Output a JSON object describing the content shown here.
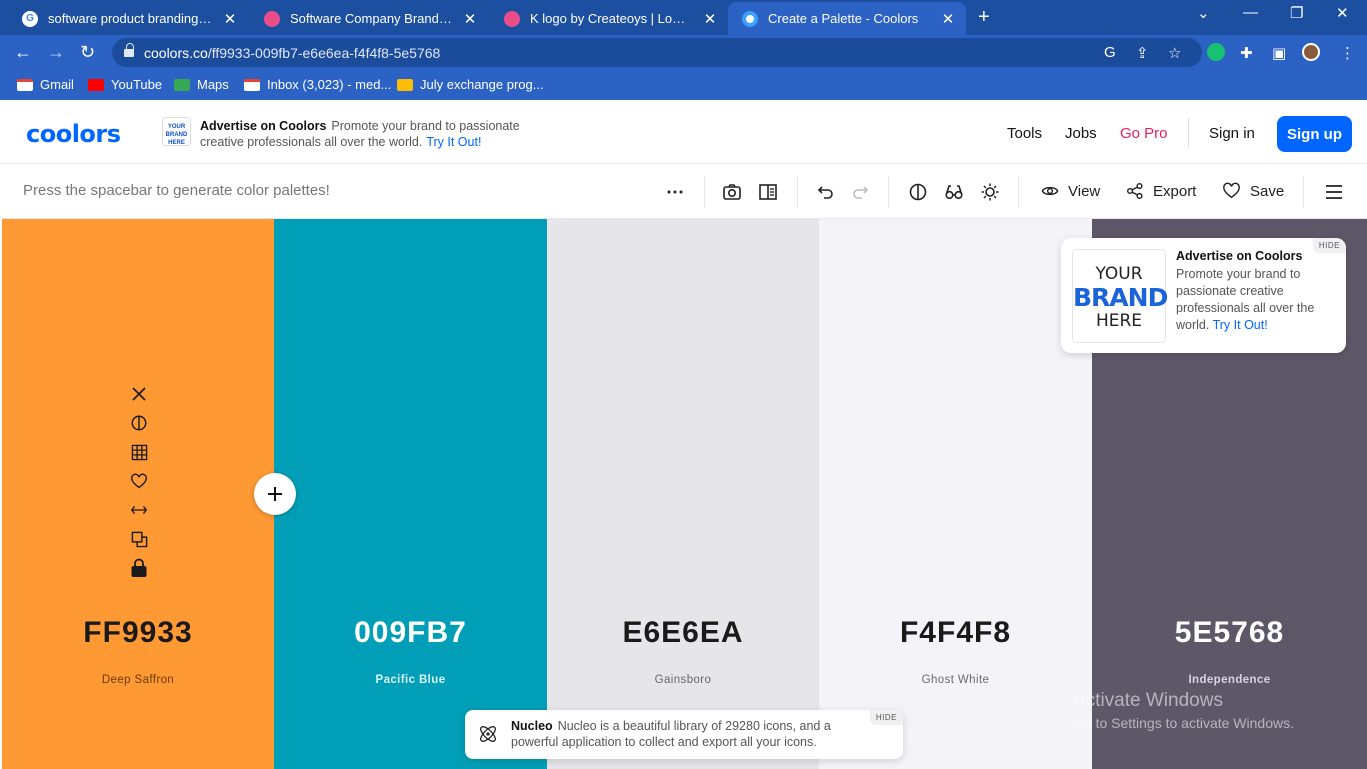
{
  "browser": {
    "tabs": [
      {
        "title": "software product branding - Goo",
        "favicon": "google-icon",
        "active": false
      },
      {
        "title": "Software Company Branding des",
        "favicon": "dribbble-icon",
        "active": false
      },
      {
        "title": "K logo by Createoys | Logo Des",
        "favicon": "dribbble-icon",
        "active": false
      },
      {
        "title": "Create a Palette - Coolors",
        "favicon": "coolors-icon",
        "active": true
      }
    ],
    "url_host": "coolors.co",
    "url_path": "/ff9933-009fb7-e6e6ea-f4f4f8-5e5768",
    "bookmarks": [
      {
        "label": "Gmail",
        "icon": "gmail-icon"
      },
      {
        "label": "YouTube",
        "icon": "youtube-icon"
      },
      {
        "label": "Maps",
        "icon": "maps-icon"
      },
      {
        "label": "Inbox (3,023) - med...",
        "icon": "gmail-icon"
      },
      {
        "label": "July exchange prog...",
        "icon": "drive-icon"
      }
    ]
  },
  "header": {
    "logo": "coolors",
    "ad_thumb": "YOUR BRAND HERE",
    "ad_title": "Advertise on Coolors",
    "ad_text": "Promote your brand to passionate creative professionals all over the world.",
    "ad_link": "Try It Out!",
    "nav": {
      "tools": "Tools",
      "jobs": "Jobs",
      "go_pro": "Go Pro",
      "sign_in": "Sign in",
      "sign_up": "Sign up"
    }
  },
  "toolbar": {
    "hint": "Press the spacebar to generate color palettes!",
    "view": "View",
    "export": "Export",
    "save": "Save"
  },
  "palette": [
    {
      "hex": "FF9933",
      "name": "Deep Saffron",
      "bg": "#ff9933",
      "fg": "#1a1a1a",
      "sub": "#6b3a0a"
    },
    {
      "hex": "009FB7",
      "name": "Pacific Blue",
      "bg": "#009fb7",
      "fg": "#ffffff",
      "sub": "#d8f4f8"
    },
    {
      "hex": "E6E6EA",
      "name": "Gainsboro",
      "bg": "#e6e6ea",
      "fg": "#1a1a1a",
      "sub": "#666670"
    },
    {
      "hex": "F4F4F8",
      "name": "Ghost White",
      "bg": "#f4f4f8",
      "fg": "#1a1a1a",
      "sub": "#6a6a72"
    },
    {
      "hex": "5E5768",
      "name": "Independence",
      "bg": "#5e5768",
      "fg": "#ffffff",
      "sub": "#d7d3de"
    }
  ],
  "ad_card": {
    "brand_line1": "YOUR",
    "brand_line2": "BRAND",
    "brand_line3": "HERE",
    "title": "Advertise on Coolors",
    "text": "Promote your brand to passionate creative professionals all over the world.",
    "link": "Try It Out!",
    "hide": "HIDE"
  },
  "nucleo": {
    "title": "Nucleo",
    "text": "Nucleo is a beautiful library of 29280 icons, and a powerful application to collect and export all your icons.",
    "hide": "HIDE"
  },
  "watermark": {
    "line1": "Activate Windows",
    "line2": "Go to Settings to activate Windows."
  }
}
